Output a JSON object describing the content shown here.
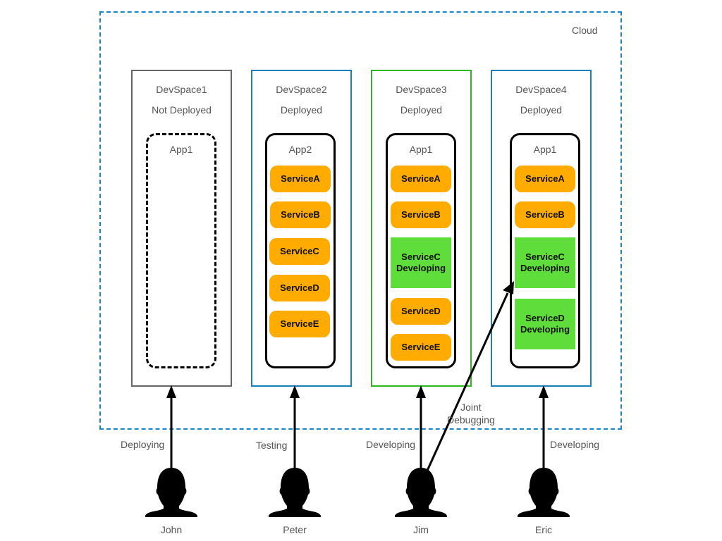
{
  "cloud": {
    "label": "Cloud",
    "border_color": "#1a85c7"
  },
  "devspaces": [
    {
      "name": "DevSpace1",
      "status": "Not Deployed",
      "border_color": "#666666",
      "app": {
        "name": "App1",
        "deployed": false,
        "services": []
      }
    },
    {
      "name": "DevSpace2",
      "status": "Deployed",
      "border_color": "#1a7fc1",
      "app": {
        "name": "App2",
        "deployed": true,
        "services": [
          {
            "name": "ServiceA",
            "state": ""
          },
          {
            "name": "ServiceB",
            "state": ""
          },
          {
            "name": "ServiceC",
            "state": ""
          },
          {
            "name": "ServiceD",
            "state": ""
          },
          {
            "name": "ServiceE",
            "state": ""
          }
        ]
      }
    },
    {
      "name": "DevSpace3",
      "status": "Deployed",
      "border_color": "#2db81e",
      "app": {
        "name": "App1",
        "deployed": true,
        "services": [
          {
            "name": "ServiceA",
            "state": ""
          },
          {
            "name": "ServiceB",
            "state": ""
          },
          {
            "name": "ServiceC",
            "state": "Developing"
          },
          {
            "name": "ServiceD",
            "state": ""
          },
          {
            "name": "ServiceE",
            "state": ""
          }
        ]
      }
    },
    {
      "name": "DevSpace4",
      "status": "Deployed",
      "border_color": "#1a7fc1",
      "app": {
        "name": "App1",
        "deployed": true,
        "services": [
          {
            "name": "ServiceA",
            "state": ""
          },
          {
            "name": "ServiceB",
            "state": ""
          },
          {
            "name": "ServiceC",
            "state": "Developing"
          },
          {
            "name": "ServiceD",
            "state": "Developing"
          }
        ]
      }
    }
  ],
  "users": [
    {
      "name": "John",
      "activity": "Deploying"
    },
    {
      "name": "Peter",
      "activity": "Testing"
    },
    {
      "name": "Jim",
      "activity": "Developing"
    },
    {
      "name": "Eric",
      "activity": "Developing"
    }
  ],
  "joint_debugging": {
    "label": "Joint\nDebugging",
    "from": "Jim",
    "to": "DevSpace4 / ServiceC"
  },
  "colors": {
    "service": "#ffab00",
    "developing": "#5fdd3a",
    "arrow": "#000000"
  }
}
